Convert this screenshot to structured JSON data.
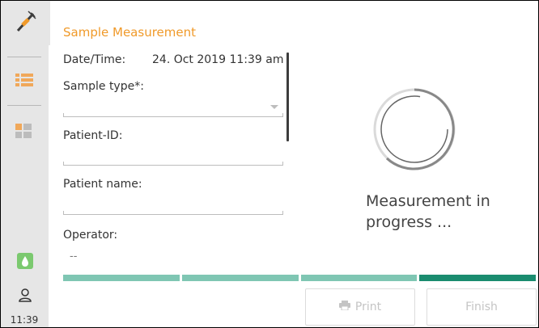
{
  "sidebar": {
    "icons": [
      "syringe-icon",
      "list-icon",
      "dashboard-icon",
      "water-drop-icon",
      "user-icon"
    ],
    "time": "11:39"
  },
  "form": {
    "title": "Sample Measurement",
    "datetime_label": "Date/Time:",
    "datetime_value": "24. Oct 2019 11:39 am",
    "sample_type_label": "Sample type*:",
    "patient_id_label": "Patient-ID:",
    "patient_name_label": "Patient name:",
    "operator_label": "Operator:",
    "operator_value": "--"
  },
  "status": {
    "message": "Measurement in progress ..."
  },
  "progress": {
    "segments_total": 4,
    "segments_complete": 3,
    "colors": {
      "complete": "#7fc6b3",
      "current": "#1a8c6f"
    }
  },
  "buttons": {
    "print_label": "Print",
    "finish_label": "Finish"
  },
  "colors": {
    "accent": "#f09a2a",
    "sidebar_bg": "#e6e6e6"
  }
}
